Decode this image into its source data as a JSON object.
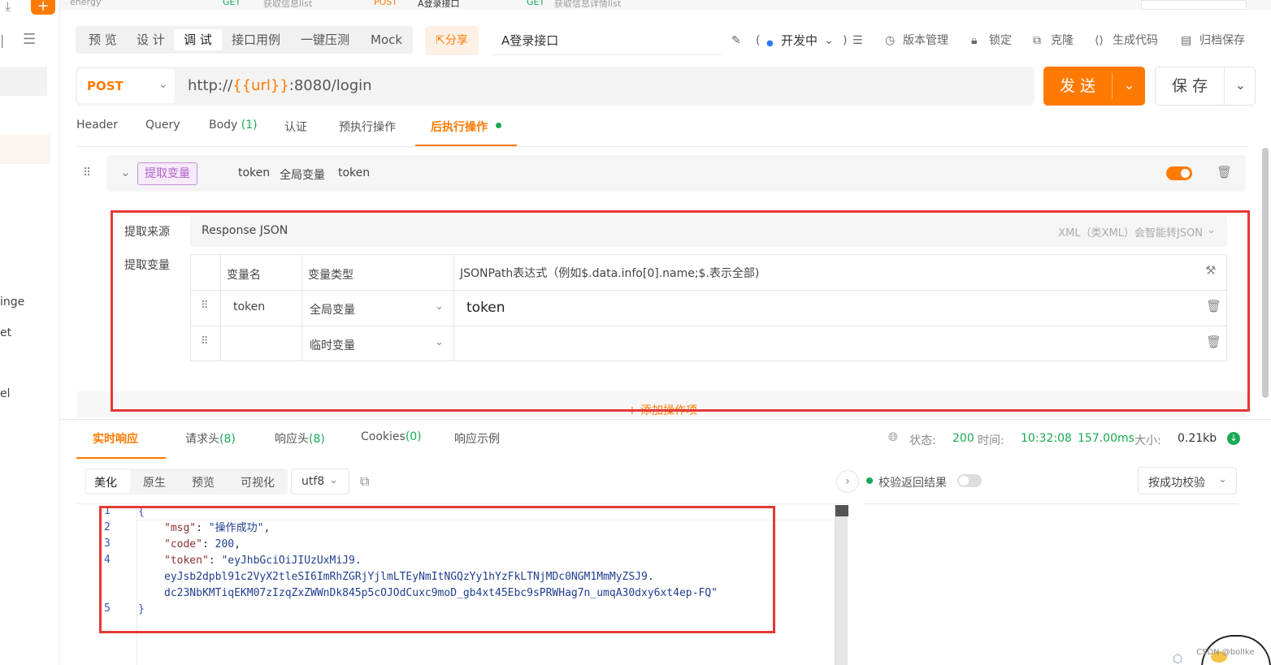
{
  "top_strip": {
    "tab1": "energy",
    "tab2_method": "GET",
    "tab2_title": "获取信息list",
    "tab3_method": "POST",
    "tab3_title": "A登录接口",
    "tab4_method": "GET",
    "tab4_title": "获取信息详情list"
  },
  "left_partial": {
    "item1": "inge",
    "item2": "et",
    "item3": "el"
  },
  "mode_tabs": [
    "预 览",
    "设 计",
    "调 试",
    "接口用例",
    "一键压测",
    "Mock"
  ],
  "share_label": "分享",
  "api_name": "A登录接口",
  "status_label": "开发中",
  "toolbar": {
    "version": "版本管理",
    "lock": "锁定",
    "clone": "克隆",
    "gen_code": "生成代码",
    "archive": "归档保存"
  },
  "method": "POST",
  "url": {
    "prefix": "http://",
    "var": "{{url}}",
    "suffix": ":8080/login"
  },
  "send_label": "发 送",
  "save_label": "保 存",
  "req_tabs": {
    "header": "Header",
    "query": "Query",
    "body": "Body",
    "body_count": "(1)",
    "auth": "认证",
    "pre": "预执行操作",
    "post": "后执行操作"
  },
  "op": {
    "badge": "提取变量",
    "var_name": "token",
    "scope": "全局变量",
    "expr": "token"
  },
  "extract": {
    "source_label": "提取来源",
    "source_value": "Response JSON",
    "source_hint": "XML（类XML）会智能转JSON",
    "var_label": "提取变量",
    "col_name": "变量名",
    "col_type": "变量类型",
    "col_expr": "JSONPath表达式（例如$.data.info[0].name;$.表示全部)",
    "rows": [
      {
        "name": "token",
        "type": "全局变量",
        "expr": "token"
      },
      {
        "name": "",
        "type": "临时变量",
        "expr": ""
      }
    ]
  },
  "add_op": "+ 添加操作项",
  "resp_tabs": {
    "live": "实时响应",
    "req_head": "请求头",
    "req_head_count": "(8)",
    "resp_head": "响应头",
    "resp_head_count": "(8)",
    "cookies": "Cookies",
    "cookies_count": "(0)",
    "example": "响应示例"
  },
  "resp_status": {
    "status_label": "状态:",
    "status": "200",
    "time_label": "时间:",
    "time": "10:32:08",
    "duration": "157.00ms",
    "size_label": "大小:",
    "size": "0.21kb"
  },
  "fmt_tabs": [
    "美化",
    "原生",
    "预览",
    "可视化"
  ],
  "encoding": "utf8",
  "validate": {
    "label": "校验返回结果",
    "mode": "按成功校验"
  },
  "code_lines": {
    "l1": "{",
    "l2k": "\"msg\"",
    "l2v": "\"操作成功\"",
    "l3k": "\"code\"",
    "l3v": "200",
    "l4k": "\"token\"",
    "l4v": "\"eyJhbGciOiJIUzUxMiJ9.",
    "l4b": "eyJsb2dpbl91c2VyX2tleSI6ImRhZGRjYjlmLTEyNmItNGQzYy1hYzFkLTNjMDc0NGM1MmMyZSJ9.",
    "l4c": "dc23NbKMTiqEKM07zIzqZxZWWnDk845p5cOJOdCuxc9moD_gb4xt45Ebc9sPRWHag7n_umqA30dxy6xt4ep-FQ\"",
    "l5": "}"
  },
  "watermark": "CSDN @bolIke",
  "colors": {
    "accent": "#ff7a00",
    "green": "#1aaa55",
    "red": "#e53935",
    "code_blue": "#1f3e8f"
  }
}
